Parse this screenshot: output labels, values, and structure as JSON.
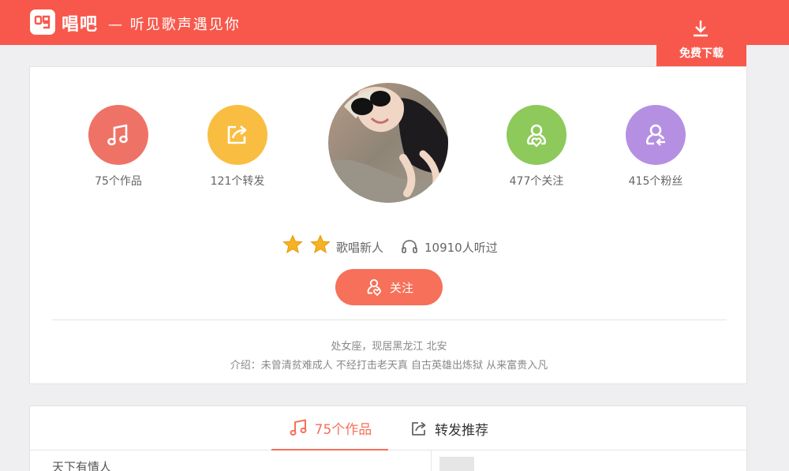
{
  "header": {
    "logo_name": "唱吧",
    "slogan": "— 听见歌声遇见你",
    "download_label": "免费下载"
  },
  "colors": {
    "brand": "#f8584c",
    "works": "#ef7267",
    "reposts": "#f9be41",
    "following": "#8dc95b",
    "fans": "#b590e2",
    "follow_button": "#f6705a"
  },
  "profile": {
    "stats": [
      {
        "icon": "music-note-icon",
        "label": "75个作品"
      },
      {
        "icon": "share-icon",
        "label": "121个转发"
      },
      {
        "icon": "heart-user-icon",
        "label": "477个关注"
      },
      {
        "icon": "fans-user-icon",
        "label": "415个粉丝"
      }
    ],
    "level_label": "歌唱新人",
    "listen_count": "10910人听过",
    "follow_label": "关注",
    "location": "处女座，现居黑龙江 北安",
    "intro": "介绍：未曾清贫难成人 不经打击老天真 自古英雄出炼狱 从来富贵入凡"
  },
  "tabs": [
    {
      "label": "75个作品",
      "icon": "music-note-icon"
    },
    {
      "label": "转发推荐",
      "icon": "share-icon"
    }
  ],
  "songs": [
    {
      "title": "天下有情人"
    }
  ]
}
